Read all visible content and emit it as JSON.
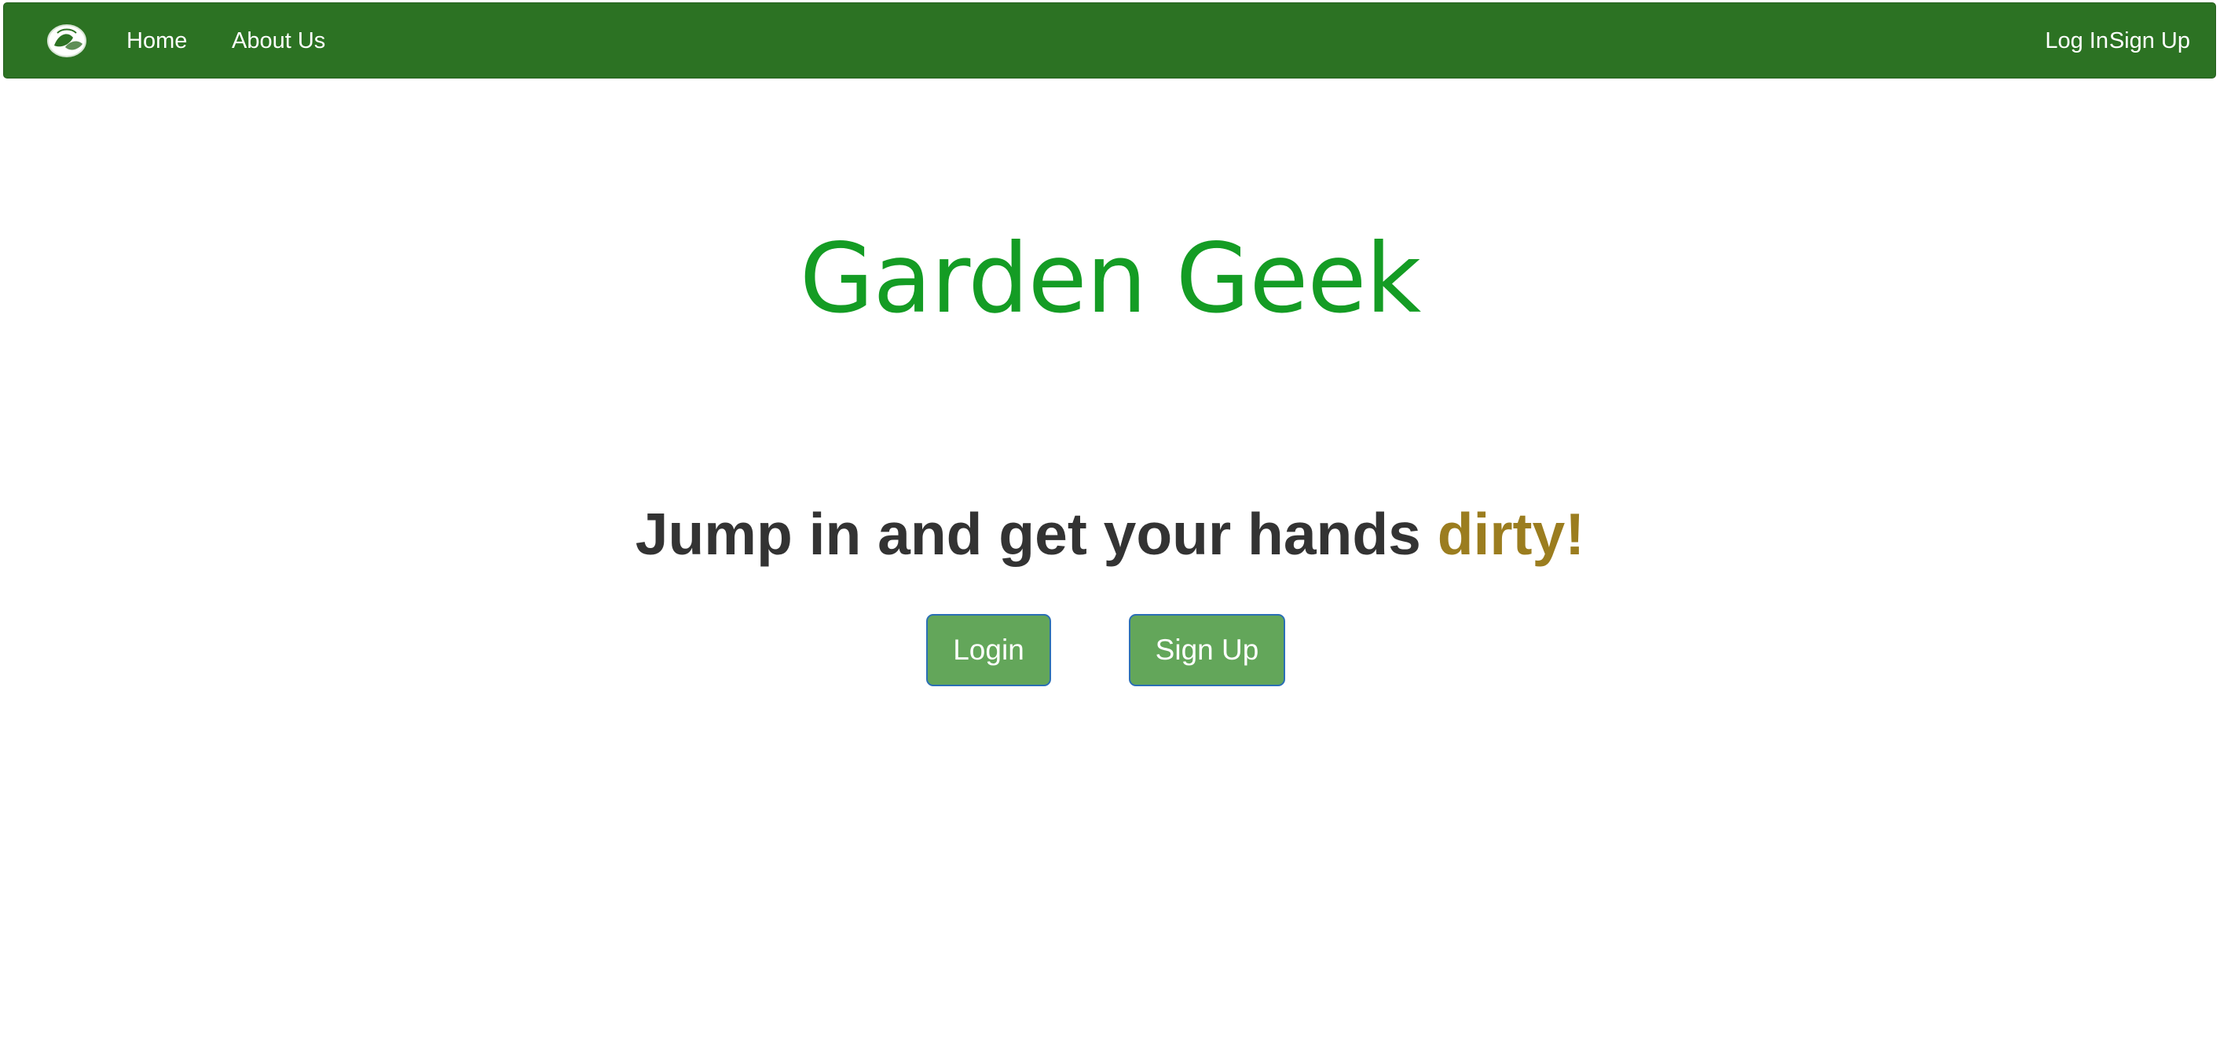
{
  "navbar": {
    "logo_icon": "globe-leaf-logo-icon",
    "links_left": [
      "Home",
      "About Us"
    ],
    "links_right": [
      "Log In",
      "Sign Up"
    ]
  },
  "hero": {
    "title": "Garden Geek",
    "tagline_main": "Jump in and get your hands ",
    "tagline_accent": "dirty!"
  },
  "actions": {
    "login_label": "Login",
    "signup_label": "Sign Up"
  },
  "colors": {
    "navbar_bg": "#2c7223",
    "title": "#149c24",
    "tagline": "#333333",
    "accent": "#9b7d1f",
    "button_bg": "#63a65a",
    "button_border": "#2b6fb5"
  }
}
